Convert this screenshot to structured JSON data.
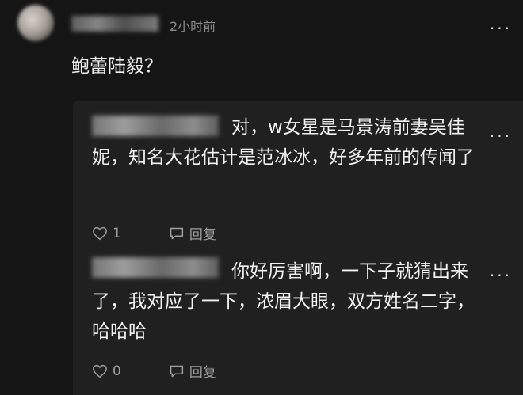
{
  "top_comment": {
    "time": "2小时前",
    "text": "鲍蕾陆毅？",
    "more_label": "···"
  },
  "replies": [
    {
      "text": "对，w女星是马景涛前妻吴佳妮，知名大花估计是范冰冰，好多年前的传闻了",
      "likes": "1",
      "reply_label": "回复",
      "more_label": "···"
    },
    {
      "text": "你好厉害啊，一下子就猜出来了，我对应了一下，浓眉大眼，双方姓名二字，哈哈哈",
      "likes": "0",
      "reply_label": "回复",
      "more_label": "···"
    }
  ],
  "icons": [
    "heart-icon",
    "comment-icon",
    "more-icon"
  ]
}
